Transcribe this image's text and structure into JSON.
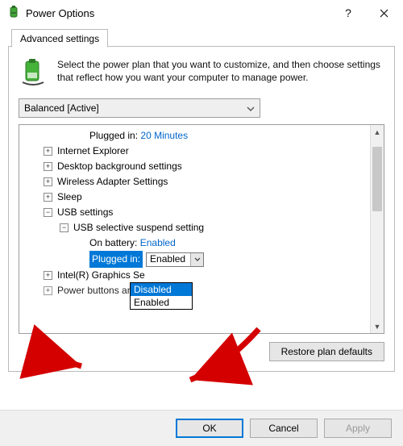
{
  "window": {
    "title": "Power Options"
  },
  "tab": {
    "label": "Advanced settings"
  },
  "intro": "Select the power plan that you want to customize, and then choose settings that reflect how you want your computer to manage power.",
  "plan": {
    "selected": "Balanced [Active]"
  },
  "tree": {
    "truncated_top_label": "Plugged in:",
    "truncated_top_value": "20 Minutes",
    "items": {
      "ie": "Internet Explorer",
      "desktop": "Desktop background settings",
      "wireless": "Wireless Adapter Settings",
      "sleep": "Sleep",
      "usb": "USB settings",
      "usb_sub": "USB selective suspend setting",
      "on_battery_label": "On battery:",
      "on_battery_value": "Enabled",
      "plugged_in_label": "Plugged in:",
      "plugged_in_value": "Enabled",
      "intel": "Intel(R) Graphics Se",
      "power_buttons": "Power buttons and"
    }
  },
  "dropdown": {
    "opt_disabled": "Disabled",
    "opt_enabled": "Enabled"
  },
  "buttons": {
    "restore": "Restore plan defaults",
    "ok": "OK",
    "cancel": "Cancel",
    "apply": "Apply"
  }
}
